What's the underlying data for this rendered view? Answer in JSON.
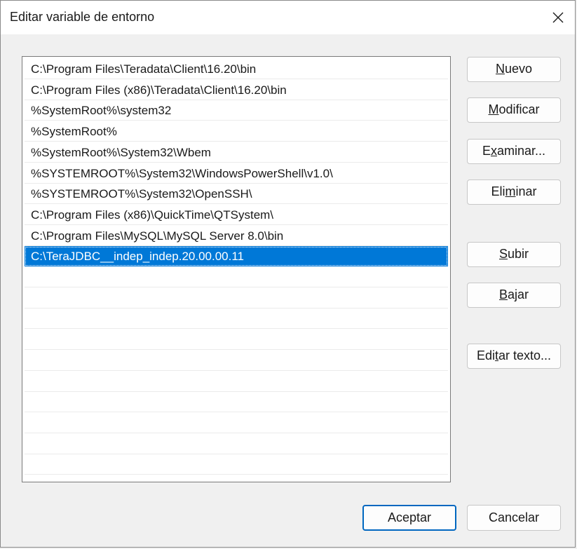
{
  "window": {
    "title": "Editar variable de entorno",
    "close_icon": "close-icon"
  },
  "paths": [
    "C:\\Program Files\\Teradata\\Client\\16.20\\bin",
    "C:\\Program Files (x86)\\Teradata\\Client\\16.20\\bin",
    "%SystemRoot%\\system32",
    "%SystemRoot%",
    "%SystemRoot%\\System32\\Wbem",
    "%SYSTEMROOT%\\System32\\WindowsPowerShell\\v1.0\\",
    "%SYSTEMROOT%\\System32\\OpenSSH\\",
    "C:\\Program Files (x86)\\QuickTime\\QTSystem\\",
    "C:\\Program Files\\MySQL\\MySQL Server 8.0\\bin",
    "C:\\TeraJDBC__indep_indep.20.00.00.11",
    "",
    "",
    "",
    "",
    "",
    "",
    "",
    "",
    "",
    ""
  ],
  "selected_index": 9,
  "buttons": {
    "nuevo": {
      "pre": "",
      "mn": "N",
      "post": "uevo"
    },
    "modificar": {
      "pre": "",
      "mn": "M",
      "post": "odificar"
    },
    "examinar": {
      "pre": "E",
      "mn": "x",
      "post": "aminar..."
    },
    "eliminar": {
      "pre": "Eli",
      "mn": "m",
      "post": "inar"
    },
    "subir": {
      "pre": "",
      "mn": "S",
      "post": "ubir"
    },
    "bajar": {
      "pre": "",
      "mn": "B",
      "post": "ajar"
    },
    "editar_texto": {
      "pre": "Edi",
      "mn": "t",
      "post": "ar texto..."
    }
  },
  "footer": {
    "ok_label": "Aceptar",
    "cancel_label": "Cancelar"
  },
  "colors": {
    "selection": "#0078d7",
    "primary_border": "#0067c0"
  }
}
